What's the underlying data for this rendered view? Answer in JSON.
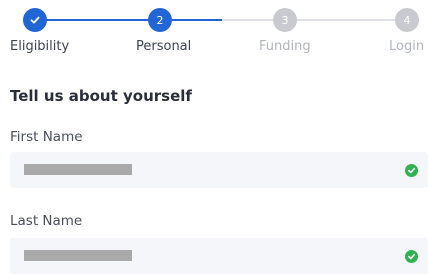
{
  "stepper": {
    "steps": [
      {
        "label": "Eligibility",
        "number": "",
        "state": "complete"
      },
      {
        "label": "Personal",
        "number": "2",
        "state": "current"
      },
      {
        "label": "Funding",
        "number": "3",
        "state": "pending"
      },
      {
        "label": "Login",
        "number": "4",
        "state": "pending"
      }
    ]
  },
  "form": {
    "heading": "Tell us about yourself",
    "first_name": {
      "label": "First Name",
      "status": "valid"
    },
    "last_name": {
      "label": "Last Name",
      "status": "valid"
    }
  },
  "colors": {
    "accent": "#2266d6",
    "success": "#2fb24f",
    "inactive": "#c8cacf"
  }
}
